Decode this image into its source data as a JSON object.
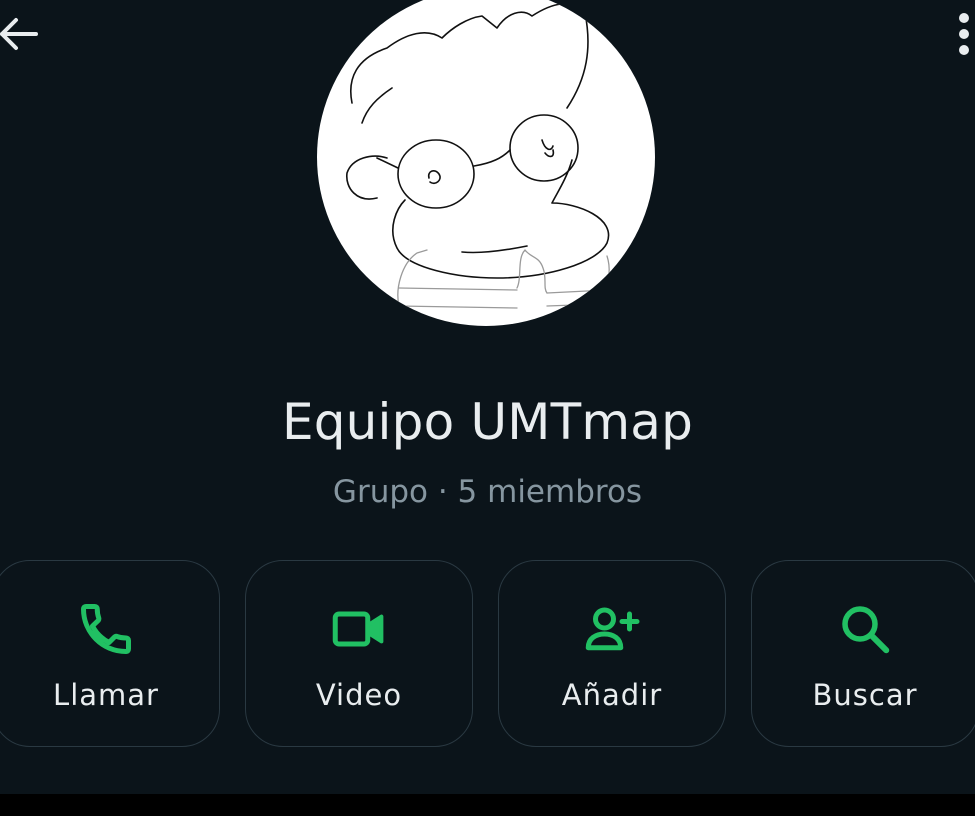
{
  "header": {
    "back_icon": "arrow-left-icon",
    "menu_icon": "more-vertical-icon"
  },
  "profile": {
    "avatar": "group-avatar-sketch",
    "name": "Equipo UMTmap",
    "meta": "Grupo · 5 miembros"
  },
  "actions": [
    {
      "label": "Llamar",
      "icon": "phone-icon"
    },
    {
      "label": "Video",
      "icon": "video-camera-icon"
    },
    {
      "label": "Añadir",
      "icon": "add-person-icon"
    },
    {
      "label": "Buscar",
      "icon": "search-icon"
    }
  ],
  "colors": {
    "background": "#0b141a",
    "accent": "#21c063",
    "text_primary": "#e9edef",
    "text_secondary": "#8696a0",
    "button_border": "#2a3942"
  }
}
